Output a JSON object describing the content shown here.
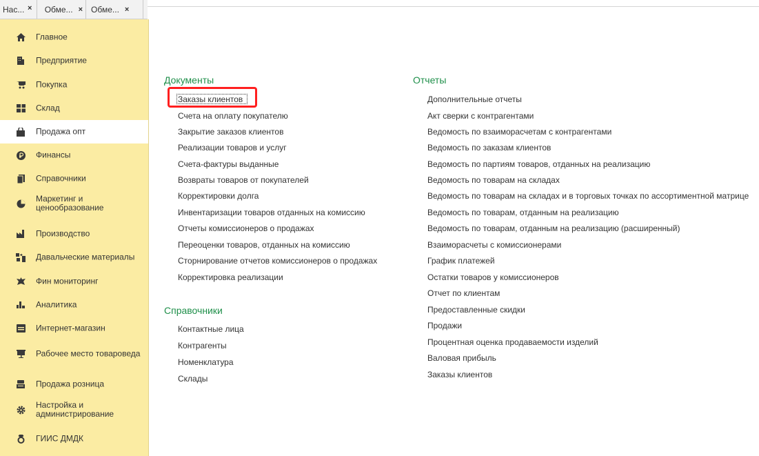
{
  "tabs": [
    {
      "label": "Нас...",
      "close": ""
    },
    {
      "label": "",
      "close": "×"
    },
    {
      "label": "Обме...",
      "close": "×"
    },
    {
      "label": "Обме...",
      "close": "×"
    }
  ],
  "sidebar": {
    "items": [
      {
        "label": "Главное",
        "icon": "home-icon"
      },
      {
        "label": "Предприятие",
        "icon": "building-icon"
      },
      {
        "label": "Покупка",
        "icon": "cart-icon"
      },
      {
        "label": "Склад",
        "icon": "warehouse-icon"
      },
      {
        "label": "Продажа опт",
        "icon": "bag-icon"
      },
      {
        "label": "Финансы",
        "icon": "coin-icon"
      },
      {
        "label": "Справочники",
        "icon": "book-icon"
      },
      {
        "label": "Маркетинг и ценообразование",
        "icon": "pie-icon"
      },
      {
        "label": "Производство",
        "icon": "factory-icon"
      },
      {
        "label": "Давальческие материалы",
        "icon": "materials-icon"
      },
      {
        "label": "Фин мониторинг",
        "icon": "emblem-icon"
      },
      {
        "label": "Аналитика",
        "icon": "bar-chart-icon"
      },
      {
        "label": "Интернет-магазин",
        "icon": "shop-icon"
      },
      {
        "label": "Рабочее место товароведа",
        "icon": "workplace-icon"
      },
      {
        "label": "Продажа розница",
        "icon": "register-icon"
      },
      {
        "label": "Настройка и администрирование",
        "icon": "gear-icon"
      },
      {
        "label": "ГИИС ДМДК",
        "icon": "ring-icon"
      }
    ]
  },
  "documents": {
    "title": "Документы",
    "items": [
      "Заказы клиентов",
      "Счета на оплату покупателю",
      "Закрытие заказов клиентов",
      "Реализации товаров и услуг",
      "Счета-фактуры выданные",
      "Возвраты товаров от покупателей",
      "Корректировки долга",
      "Инвентаризации товаров отданных на комиссию",
      "Отчеты комиссионеров о продажах",
      "Переоценки товаров, отданных на комиссию",
      "Сторнирование отчетов комиссионеров о продажах",
      "Корректировка реализации"
    ]
  },
  "catalogs": {
    "title": "Справочники",
    "items": [
      "Контактные лица",
      "Контрагенты",
      "Номенклатура",
      "Склады"
    ]
  },
  "reports": {
    "title": "Отчеты",
    "items": [
      "Дополнительные отчеты",
      "Акт сверки с контрагентами",
      "Ведомость по взаиморасчетам с контрагентами",
      "Ведомость по заказам клиентов",
      "Ведомость по партиям товаров, отданных на реализацию",
      "Ведомость по товарам на складах",
      "Ведомость по товарам на складах и в торговых точках по ассортиментной матрице",
      "Ведомость по товарам, отданным на реализацию",
      "Ведомость по товарам, отданным на реализацию (расширенный)",
      "Взаиморасчеты с комиссионерами",
      "График платежей",
      "Остатки товаров у комиссионеров",
      "Отчет по клиентам",
      "Предоставленные скидки",
      "Продажи",
      "Процентная оценка продаваемости изделий",
      "Валовая прибыль",
      "Заказы клиентов"
    ]
  },
  "colors": {
    "sidebar_bg": "#fbeca3",
    "section_title": "#1f8f4a",
    "highlight": "#ff1f1f"
  }
}
